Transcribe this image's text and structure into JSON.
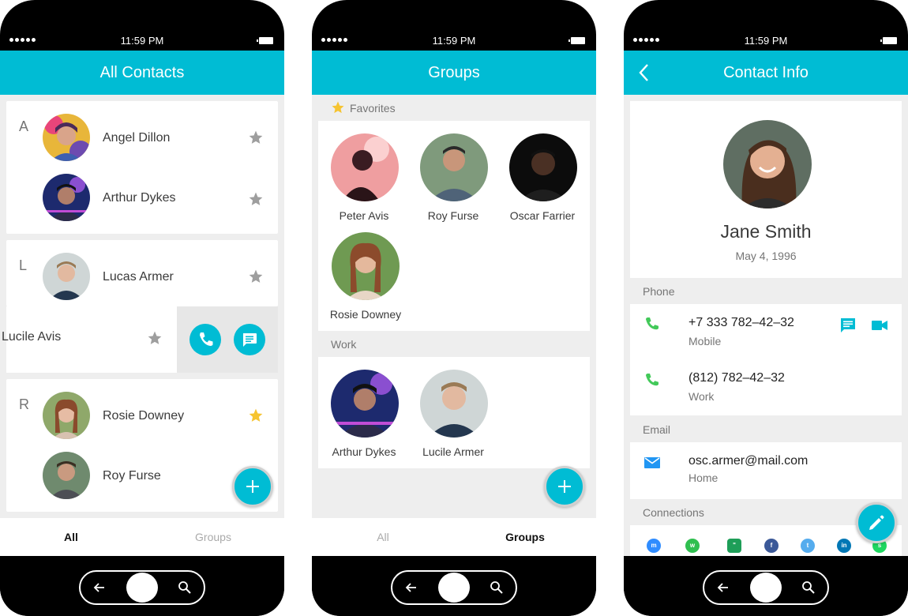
{
  "status": {
    "time": "11:59 PM"
  },
  "phone1": {
    "title": "All Contacts",
    "sections": [
      {
        "letter": "A",
        "contacts": [
          {
            "name": "Angel Dillon",
            "favorite": false
          },
          {
            "name": "Arthur Dykes",
            "favorite": false
          }
        ]
      },
      {
        "letter": "L",
        "contacts": [
          {
            "name": "Lucas Armer",
            "favorite": false
          },
          {
            "name": "Lucile Avis",
            "favorite": false
          }
        ]
      },
      {
        "letter": "R",
        "contacts": [
          {
            "name": "Rosie Downey",
            "favorite": true
          },
          {
            "name": "Roy Furse",
            "favorite": false
          }
        ]
      }
    ],
    "tabs": {
      "all": "All",
      "groups": "Groups",
      "active": "All"
    }
  },
  "phone2": {
    "title": "Groups",
    "favorites_label": "Favorites",
    "favorites": [
      {
        "name": "Peter Avis"
      },
      {
        "name": "Roy Furse"
      },
      {
        "name": "Oscar Farrier"
      },
      {
        "name": "Rosie Downey"
      }
    ],
    "work_label": "Work",
    "work": [
      {
        "name": "Arthur Dykes"
      },
      {
        "name": "Lucile Armer"
      }
    ],
    "tabs": {
      "all": "All",
      "groups": "Groups",
      "active": "Groups"
    }
  },
  "phone3": {
    "title": "Contact Info",
    "name": "Jane Smith",
    "birthday": "May 4, 1996",
    "phone_label": "Phone",
    "phones": [
      {
        "number": "+7 333 782–42–32",
        "type": "Mobile"
      },
      {
        "number": "(812) 782–42–32",
        "type": "Work"
      }
    ],
    "email_label": "Email",
    "email": {
      "address": "osc.armer@mail.com",
      "type": "Home"
    },
    "connections_label": "Connections",
    "connections": [
      "messenger-icon",
      "whatsapp-icon",
      "hangouts-icon",
      "facebook-icon",
      "twitter-icon",
      "linkedin-icon",
      "spotify-icon"
    ]
  },
  "colors": {
    "accent": "#00bcd4",
    "star_active": "#f6c431",
    "star_inactive": "#9e9e9e",
    "phone_green": "#43c95a",
    "background": "#eeeeee"
  }
}
